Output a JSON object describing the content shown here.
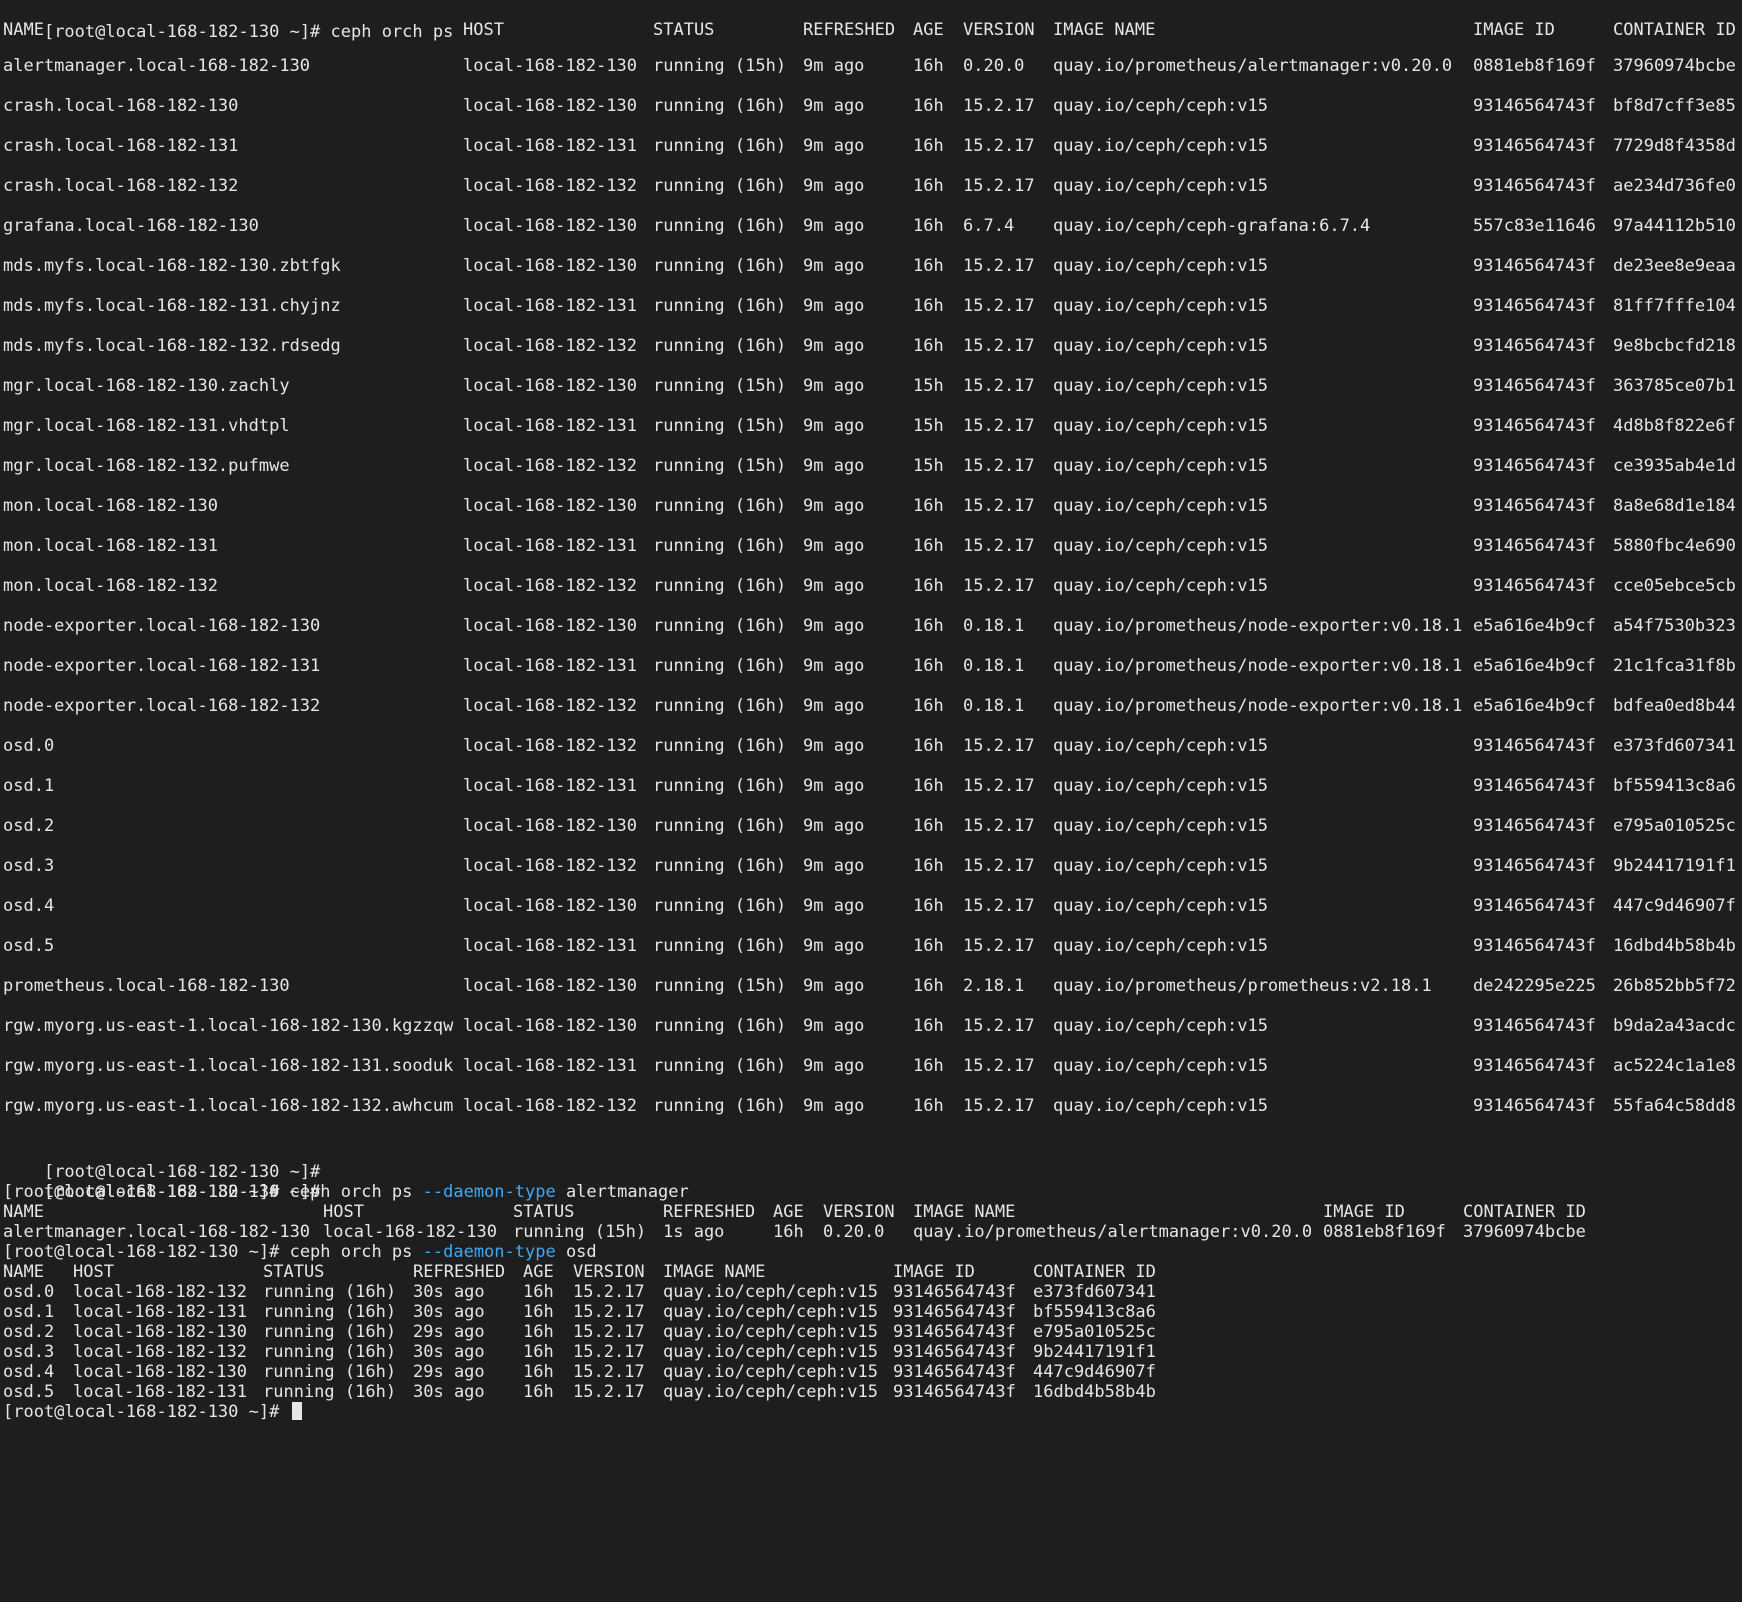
{
  "first_command": "[root@local-168-182-130 ~]# ceph orch ps",
  "table": {
    "headers": [
      "NAME",
      "HOST",
      "STATUS",
      "REFRESHED",
      "AGE",
      "VERSION",
      "IMAGE NAME",
      "IMAGE ID",
      "CONTAINER ID"
    ],
    "rows": [
      [
        "alertmanager.local-168-182-130",
        "local-168-182-130",
        "running (15h)",
        "9m ago",
        "16h",
        "0.20.0",
        "quay.io/prometheus/alertmanager:v0.20.0",
        "0881eb8f169f",
        "37960974bcbe"
      ],
      [
        "crash.local-168-182-130",
        "local-168-182-130",
        "running (16h)",
        "9m ago",
        "16h",
        "15.2.17",
        "quay.io/ceph/ceph:v15",
        "93146564743f",
        "bf8d7cff3e85"
      ],
      [
        "crash.local-168-182-131",
        "local-168-182-131",
        "running (16h)",
        "9m ago",
        "16h",
        "15.2.17",
        "quay.io/ceph/ceph:v15",
        "93146564743f",
        "7729d8f4358d"
      ],
      [
        "crash.local-168-182-132",
        "local-168-182-132",
        "running (16h)",
        "9m ago",
        "16h",
        "15.2.17",
        "quay.io/ceph/ceph:v15",
        "93146564743f",
        "ae234d736fe0"
      ],
      [
        "grafana.local-168-182-130",
        "local-168-182-130",
        "running (16h)",
        "9m ago",
        "16h",
        "6.7.4",
        "quay.io/ceph/ceph-grafana:6.7.4",
        "557c83e11646",
        "97a44112b510"
      ],
      [
        "mds.myfs.local-168-182-130.zbtfgk",
        "local-168-182-130",
        "running (16h)",
        "9m ago",
        "16h",
        "15.2.17",
        "quay.io/ceph/ceph:v15",
        "93146564743f",
        "de23ee8e9eaa"
      ],
      [
        "mds.myfs.local-168-182-131.chyjnz",
        "local-168-182-131",
        "running (16h)",
        "9m ago",
        "16h",
        "15.2.17",
        "quay.io/ceph/ceph:v15",
        "93146564743f",
        "81ff7fffe104"
      ],
      [
        "mds.myfs.local-168-182-132.rdsedg",
        "local-168-182-132",
        "running (16h)",
        "9m ago",
        "16h",
        "15.2.17",
        "quay.io/ceph/ceph:v15",
        "93146564743f",
        "9e8bcbcfd218"
      ],
      [
        "mgr.local-168-182-130.zachly",
        "local-168-182-130",
        "running (15h)",
        "9m ago",
        "15h",
        "15.2.17",
        "quay.io/ceph/ceph:v15",
        "93146564743f",
        "363785ce07b1"
      ],
      [
        "mgr.local-168-182-131.vhdtpl",
        "local-168-182-131",
        "running (15h)",
        "9m ago",
        "15h",
        "15.2.17",
        "quay.io/ceph/ceph:v15",
        "93146564743f",
        "4d8b8f822e6f"
      ],
      [
        "mgr.local-168-182-132.pufmwe",
        "local-168-182-132",
        "running (15h)",
        "9m ago",
        "15h",
        "15.2.17",
        "quay.io/ceph/ceph:v15",
        "93146564743f",
        "ce3935ab4e1d"
      ],
      [
        "mon.local-168-182-130",
        "local-168-182-130",
        "running (16h)",
        "9m ago",
        "16h",
        "15.2.17",
        "quay.io/ceph/ceph:v15",
        "93146564743f",
        "8a8e68d1e184"
      ],
      [
        "mon.local-168-182-131",
        "local-168-182-131",
        "running (16h)",
        "9m ago",
        "16h",
        "15.2.17",
        "quay.io/ceph/ceph:v15",
        "93146564743f",
        "5880fbc4e690"
      ],
      [
        "mon.local-168-182-132",
        "local-168-182-132",
        "running (16h)",
        "9m ago",
        "16h",
        "15.2.17",
        "quay.io/ceph/ceph:v15",
        "93146564743f",
        "cce05ebce5cb"
      ],
      [
        "node-exporter.local-168-182-130",
        "local-168-182-130",
        "running (16h)",
        "9m ago",
        "16h",
        "0.18.1",
        "quay.io/prometheus/node-exporter:v0.18.1",
        "e5a616e4b9cf",
        "a54f7530b323"
      ],
      [
        "node-exporter.local-168-182-131",
        "local-168-182-131",
        "running (16h)",
        "9m ago",
        "16h",
        "0.18.1",
        "quay.io/prometheus/node-exporter:v0.18.1",
        "e5a616e4b9cf",
        "21c1fca31f8b"
      ],
      [
        "node-exporter.local-168-182-132",
        "local-168-182-132",
        "running (16h)",
        "9m ago",
        "16h",
        "0.18.1",
        "quay.io/prometheus/node-exporter:v0.18.1",
        "e5a616e4b9cf",
        "bdfea0ed8b44"
      ],
      [
        "osd.0",
        "local-168-182-132",
        "running (16h)",
        "9m ago",
        "16h",
        "15.2.17",
        "quay.io/ceph/ceph:v15",
        "93146564743f",
        "e373fd607341"
      ],
      [
        "osd.1",
        "local-168-182-131",
        "running (16h)",
        "9m ago",
        "16h",
        "15.2.17",
        "quay.io/ceph/ceph:v15",
        "93146564743f",
        "bf559413c8a6"
      ],
      [
        "osd.2",
        "local-168-182-130",
        "running (16h)",
        "9m ago",
        "16h",
        "15.2.17",
        "quay.io/ceph/ceph:v15",
        "93146564743f",
        "e795a010525c"
      ],
      [
        "osd.3",
        "local-168-182-132",
        "running (16h)",
        "9m ago",
        "16h",
        "15.2.17",
        "quay.io/ceph/ceph:v15",
        "93146564743f",
        "9b24417191f1"
      ],
      [
        "osd.4",
        "local-168-182-130",
        "running (16h)",
        "9m ago",
        "16h",
        "15.2.17",
        "quay.io/ceph/ceph:v15",
        "93146564743f",
        "447c9d46907f"
      ],
      [
        "osd.5",
        "local-168-182-131",
        "running (16h)",
        "9m ago",
        "16h",
        "15.2.17",
        "quay.io/ceph/ceph:v15",
        "93146564743f",
        "16dbd4b58b4b"
      ],
      [
        "prometheus.local-168-182-130",
        "local-168-182-130",
        "running (15h)",
        "9m ago",
        "16h",
        "2.18.1",
        "quay.io/prometheus/prometheus:v2.18.1",
        "de242295e225",
        "26b852bb5f72"
      ],
      [
        "rgw.myorg.us-east-1.local-168-182-130.kgzzqw",
        "local-168-182-130",
        "running (16h)",
        "9m ago",
        "16h",
        "15.2.17",
        "quay.io/ceph/ceph:v15",
        "93146564743f",
        "b9da2a43acdc"
      ],
      [
        "rgw.myorg.us-east-1.local-168-182-131.sooduk",
        "local-168-182-131",
        "running (16h)",
        "9m ago",
        "16h",
        "15.2.17",
        "quay.io/ceph/ceph:v15",
        "93146564743f",
        "ac5224c1a1e8"
      ],
      [
        "rgw.myorg.us-east-1.local-168-182-132.awhcum",
        "local-168-182-132",
        "running (16h)",
        "9m ago",
        "16h",
        "15.2.17",
        "quay.io/ceph/ceph:v15",
        "93146564743f",
        "55fa64c58dd8"
      ]
    ]
  },
  "prompt": "[root@local-168-182-130 ~]#",
  "command_alertmanager": {
    "base": " ceph orch ps ",
    "flag": "--daemon-type",
    "arg": " alertmanager"
  },
  "alertmanager_table": {
    "headers": [
      "NAME",
      "HOST",
      "STATUS",
      "REFRESHED",
      "AGE",
      "VERSION",
      "IMAGE NAME",
      "IMAGE ID",
      "CONTAINER ID"
    ],
    "row": [
      "alertmanager.local-168-182-130",
      "local-168-182-130",
      "running (15h)",
      "1s ago",
      "16h",
      "0.20.0",
      "quay.io/prometheus/alertmanager:v0.20.0",
      "0881eb8f169f",
      "37960974bcbe"
    ]
  },
  "command_osd": {
    "base": " ceph orch ps ",
    "flag": "--daemon-type",
    "arg": " osd"
  },
  "osd_table": {
    "headers": [
      "NAME",
      "HOST",
      "STATUS",
      "REFRESHED",
      "AGE",
      "VERSION",
      "IMAGE NAME",
      "IMAGE ID",
      "CONTAINER ID"
    ],
    "rows": [
      [
        "osd.0",
        "local-168-182-132",
        "running (16h)",
        "30s ago",
        "16h",
        "15.2.17",
        "quay.io/ceph/ceph:v15",
        "93146564743f",
        "e373fd607341"
      ],
      [
        "osd.1",
        "local-168-182-131",
        "running (16h)",
        "30s ago",
        "16h",
        "15.2.17",
        "quay.io/ceph/ceph:v15",
        "93146564743f",
        "bf559413c8a6"
      ],
      [
        "osd.2",
        "local-168-182-130",
        "running (16h)",
        "29s ago",
        "16h",
        "15.2.17",
        "quay.io/ceph/ceph:v15",
        "93146564743f",
        "e795a010525c"
      ],
      [
        "osd.3",
        "local-168-182-132",
        "running (16h)",
        "30s ago",
        "16h",
        "15.2.17",
        "quay.io/ceph/ceph:v15",
        "93146564743f",
        "9b24417191f1"
      ],
      [
        "osd.4",
        "local-168-182-130",
        "running (16h)",
        "29s ago",
        "16h",
        "15.2.17",
        "quay.io/ceph/ceph:v15",
        "93146564743f",
        "447c9d46907f"
      ],
      [
        "osd.5",
        "local-168-182-131",
        "running (16h)",
        "30s ago",
        "16h",
        "15.2.17",
        "quay.io/ceph/ceph:v15",
        "93146564743f",
        "16dbd4b58b4b"
      ]
    ]
  }
}
